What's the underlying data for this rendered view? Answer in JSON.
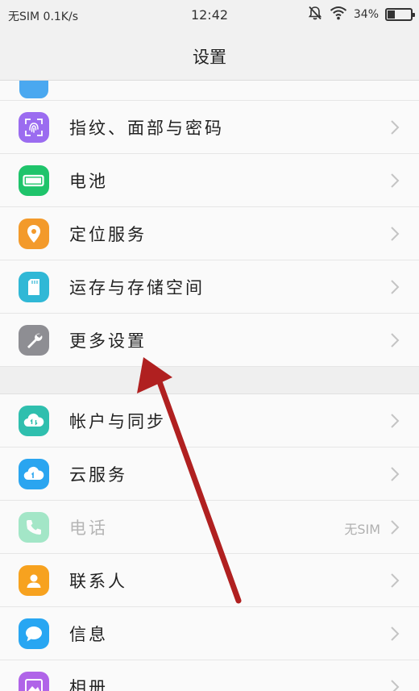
{
  "status_bar": {
    "carrier": "无SIM 0.1K/s",
    "time": "12:42",
    "battery_percent": "34%",
    "battery_level": 0.34
  },
  "header": {
    "title": "设置"
  },
  "colors": {
    "fingerprint": "#9b6cf0",
    "battery": "#1fc46b",
    "location": "#f39a2b",
    "storage": "#30b8d6",
    "more": "#8e8e93",
    "account": "#2fbfae",
    "cloud": "#2aa5f0",
    "phone": "#3ad08a",
    "contacts": "#f7a21f",
    "messages": "#28a6f2",
    "gallery": "#b064e8",
    "arrow": "#b02020"
  },
  "group1": [
    {
      "label": "指纹、面部与密码",
      "icon": "fingerprint-icon"
    },
    {
      "label": "电池",
      "icon": "battery-icon"
    },
    {
      "label": "定位服务",
      "icon": "location-pin-icon"
    },
    {
      "label": "运存与存储空间",
      "icon": "sd-card-icon"
    },
    {
      "label": "更多设置",
      "icon": "wrench-icon"
    }
  ],
  "group2": [
    {
      "label": "帐户与同步",
      "icon": "sync-cloud-icon"
    },
    {
      "label": "云服务",
      "icon": "cloud-icon"
    },
    {
      "label": "电话",
      "icon": "phone-icon",
      "value": "无SIM",
      "disabled": true
    },
    {
      "label": "联系人",
      "icon": "contacts-icon"
    },
    {
      "label": "信息",
      "icon": "message-icon"
    },
    {
      "label": "相册",
      "icon": "gallery-icon"
    }
  ]
}
